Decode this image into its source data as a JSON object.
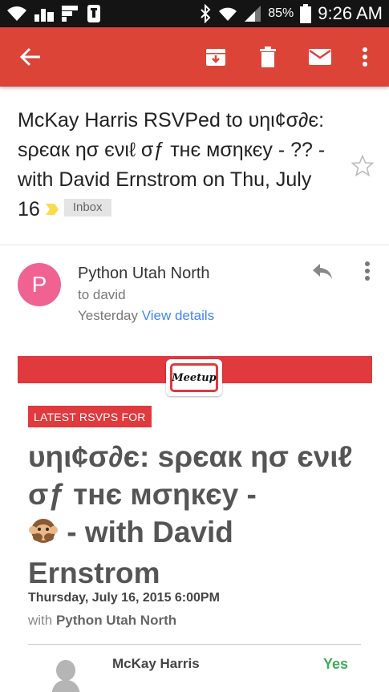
{
  "status_bar": {
    "battery": "85%",
    "time": "9:26 AM"
  },
  "email": {
    "subject": "McKay Harris RSVPed to υηι¢σ∂є: sρєαк ησ єνιℓ σƒ тнє мσηкєу - ?? - with David Ernstrom on Thu, July 16",
    "label": "Inbox"
  },
  "sender": {
    "initial": "P",
    "name": "Python Utah North",
    "to": "to david",
    "date": "Yesterday",
    "details_link": "View details"
  },
  "body": {
    "logo_text": "Meetup",
    "badge": "LATEST RSVPS FOR",
    "event_title_pre": "υηι¢σ∂є: sρєαк ησ єνιℓ σƒ тнє мσηкєу -",
    "event_title_post": " - with David Ernstrom",
    "event_date": "Thursday, July 16, 2015 6:00PM",
    "with_prefix": "with",
    "group_name": "Python Utah North",
    "rsvp": {
      "name": "McKay Harris",
      "response": "Yes"
    }
  },
  "colors": {
    "app_bar": "#dc4437",
    "avatar": "#f06292",
    "meetup_red": "#e0393e",
    "link": "#4285f4",
    "yes": "#3dae5c"
  }
}
